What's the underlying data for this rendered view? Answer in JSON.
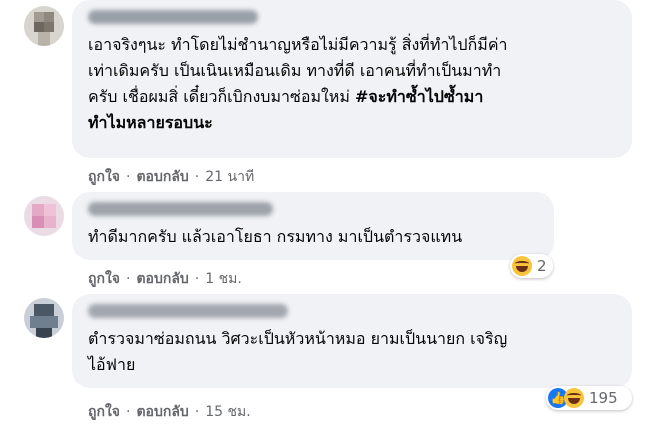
{
  "comments": [
    {
      "text_lines": [
        "เอาจริงๆนะ ทำโดยไม่ชำนาญหรือไม่มีความรู้ สิ่งที่ทำไปก็มีค่า",
        "เท่าเดิมครับ เป็นเนินเหมือนเดิม ทางที่ดี เอาคนที่ทำเป็นมาทำ",
        "ครับ เชื่อผมสิ่ เดี๋ยวก็เบิกงบมาซ่อมใหม่ "
      ],
      "hashtag_line3": "#จะทำซ้ำไปซ้ำมา",
      "hashtag_line4": "ทำไมหลายรอบนะ",
      "like_label": "ถูกใจ",
      "reply_label": "ตอบกลับ",
      "time": "21 นาที"
    },
    {
      "text": "ทำดีมากครับ แล้วเอาโยธา กรมทาง มาเป็นตำรวจแทน",
      "like_label": "ถูกใจ",
      "reply_label": "ตอบกลับ",
      "time": "1 ชม.",
      "reaction_count": "2",
      "reaction_icons": [
        "haha-icon"
      ]
    },
    {
      "text_lines": [
        "ตำรวจมาซ่อมถนน วิศวะเป็นหัวหน้าหมอ ยามเป็นนายก เจริญ",
        "ไอ้ฟาย"
      ],
      "like_label": "ถูกใจ",
      "reply_label": "ตอบกลับ",
      "time": "15 ชม.",
      "reaction_count": "195",
      "reaction_icons": [
        "like-icon",
        "haha-icon"
      ]
    }
  ],
  "separator": "·",
  "colors": {
    "bubble": "#f0f2f5",
    "meta": "#65676b",
    "text": "#050505"
  }
}
